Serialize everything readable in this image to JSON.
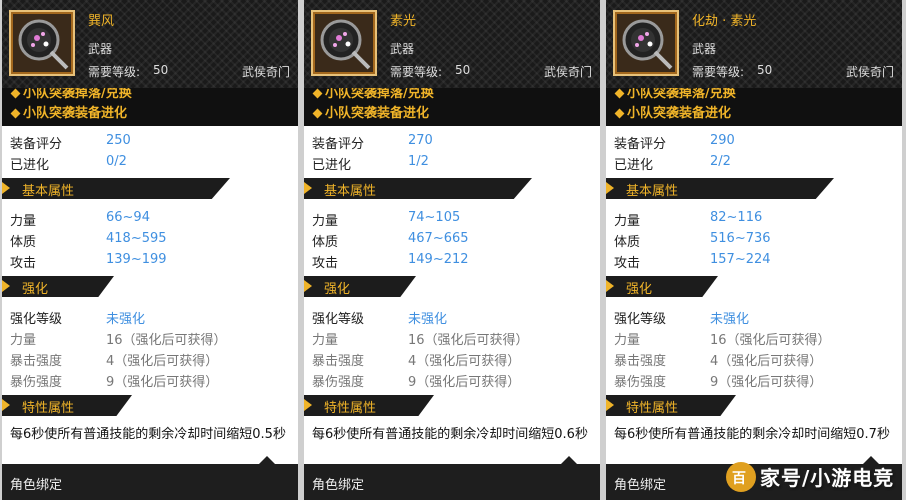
{
  "panels": [
    {
      "name": "巽风",
      "type": "武器",
      "req_label": "需要等级:",
      "req_value": "50",
      "school": "武侯奇门",
      "sources": [
        "小队突袭掉落/兑换",
        "小队突袭装备进化"
      ],
      "score_label": "装备评分",
      "score": "250",
      "evolved_label": "已进化",
      "evolved": "0/2",
      "basic_title": "基本属性",
      "stats": [
        {
          "label": "力量",
          "value": "66~94"
        },
        {
          "label": "体质",
          "value": "418~595"
        },
        {
          "label": "攻击",
          "value": "139~199"
        }
      ],
      "enhance_title": "强化",
      "enhance_level_label": "强化等级",
      "enhance_level": "未强化",
      "enhance_stats": [
        {
          "label": "力量",
          "value": "16（强化后可获得）"
        },
        {
          "label": "暴击强度",
          "value": "4（强化后可获得）"
        },
        {
          "label": "暴伤强度",
          "value": "9（强化后可获得）"
        }
      ],
      "trait_title": "特性属性",
      "trait_desc": "每6秒使所有普通技能的剩余冷却时间缩短0.5秒",
      "bind": "角色绑定"
    },
    {
      "name": "素光",
      "type": "武器",
      "req_label": "需要等级:",
      "req_value": "50",
      "school": "武侯奇门",
      "sources": [
        "小队突袭掉落/兑换",
        "小队突袭装备进化"
      ],
      "score_label": "装备评分",
      "score": "270",
      "evolved_label": "已进化",
      "evolved": "1/2",
      "basic_title": "基本属性",
      "stats": [
        {
          "label": "力量",
          "value": "74~105"
        },
        {
          "label": "体质",
          "value": "467~665"
        },
        {
          "label": "攻击",
          "value": "149~212"
        }
      ],
      "enhance_title": "强化",
      "enhance_level_label": "强化等级",
      "enhance_level": "未强化",
      "enhance_stats": [
        {
          "label": "力量",
          "value": "16（强化后可获得）"
        },
        {
          "label": "暴击强度",
          "value": "4（强化后可获得）"
        },
        {
          "label": "暴伤强度",
          "value": "9（强化后可获得）"
        }
      ],
      "trait_title": "特性属性",
      "trait_desc": "每6秒使所有普通技能的剩余冷却时间缩短0.6秒",
      "bind": "角色绑定"
    },
    {
      "name": "化劫 · 素光",
      "type": "武器",
      "req_label": "需要等级:",
      "req_value": "50",
      "school": "武侯奇门",
      "sources": [
        "小队突袭掉落/兑换",
        "小队突袭装备进化"
      ],
      "score_label": "装备评分",
      "score": "290",
      "evolved_label": "已进化",
      "evolved": "2/2",
      "basic_title": "基本属性",
      "stats": [
        {
          "label": "力量",
          "value": "82~116"
        },
        {
          "label": "体质",
          "value": "516~736"
        },
        {
          "label": "攻击",
          "value": "157~224"
        }
      ],
      "enhance_title": "强化",
      "enhance_level_label": "强化等级",
      "enhance_level": "未强化",
      "enhance_stats": [
        {
          "label": "力量",
          "value": "16（强化后可获得）"
        },
        {
          "label": "暴击强度",
          "value": "4（强化后可获得）"
        },
        {
          "label": "暴伤强度",
          "value": "9（强化后可获得）"
        }
      ],
      "trait_title": "特性属性",
      "trait_desc": "每6秒使所有普通技能的剩余冷却时间缩短0.7秒",
      "bind": "角色绑定"
    }
  ],
  "watermark": {
    "logo_char": "百",
    "text": "家号/小游电竞"
  },
  "colors": {
    "accent": "#f0b429",
    "value_blue": "#3f8fe0",
    "dark": "#1c1c1c"
  },
  "icons": {
    "weapon": "fan-weapon-icon",
    "bullet": "diamond-icon",
    "section": "chevron-right-icon"
  }
}
